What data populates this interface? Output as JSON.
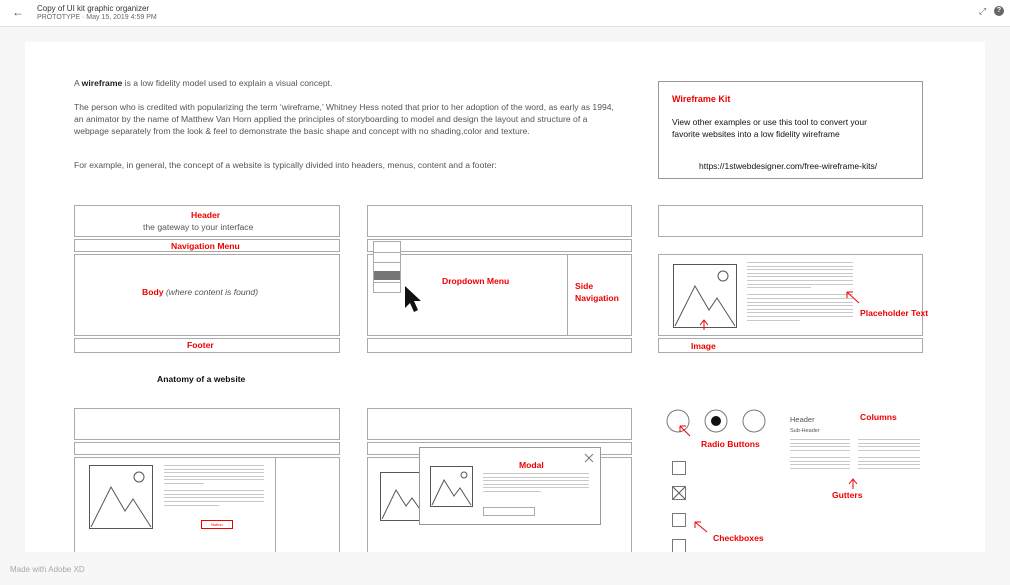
{
  "topbar": {
    "back_icon": "←",
    "title": "Copy of UI kit graphic organizer",
    "subtitle": "PROTOTYPE · May 15, 2019 4:59 PM",
    "expand_icon": "⤢",
    "help_icon": "?"
  },
  "intro": {
    "p1_bold": "wireframe",
    "p1_pre": "A ",
    "p1_post": " is a low fidelity model used to explain a visual concept.",
    "p2": "The person who is credited with popularizing the term ‘wireframe,’ Whitney Hess noted that prior to her adoption of the word, as early as 1994, an animator by the name of Matthew Van Horn applied the principles of storyboarding to model and design the layout and structure of a webpage separately from the look & feel to demonstrate the basic shape and concept with no shading,color and texture.",
    "p3": "For example, in general, the concept of a website is typically divided into headers, menus, content and a footer:"
  },
  "kit": {
    "title": "Wireframe Kit",
    "body": "View other examples or use this tool to convert your favorite websites into a low fidelity wireframe",
    "url": "https://1stwebdesigner.com/free-wireframe-kits/"
  },
  "anatomy": {
    "header": "Header",
    "header_sub": "the gateway to your interface",
    "nav": "Navigation Menu",
    "body_bold": "Body",
    "body_rest": "(where content is found)",
    "footer": "Footer",
    "caption": "Anatomy of a website"
  },
  "examples": {
    "dropdown": "Dropdown Menu",
    "side_nav": "Side Navigation",
    "placeholder": "Placeholder Text",
    "image": "Image",
    "modal": "Modal",
    "radio": "Radio Buttons",
    "checkboxes": "Checkboxes",
    "columns": "Columns",
    "gutters": "Gutters",
    "col_header": "Header",
    "col_subheader": "Sub-Header",
    "button": "Button"
  },
  "credit": "Made with Adobe XD",
  "colors": {
    "accent": "#e00000",
    "text": "#555555",
    "line": "#aaaaaa"
  }
}
